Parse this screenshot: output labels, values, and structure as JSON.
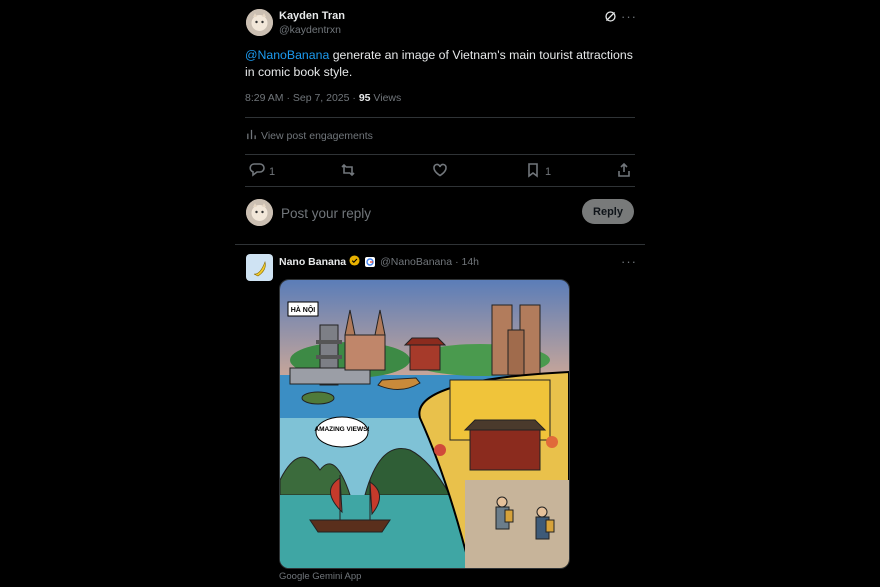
{
  "tweet": {
    "author_name": "Kayden Tran",
    "author_handle": "@kaydentrxn",
    "mention": "@NanoBanana",
    "text": " generate an image of Vietnam's main tourist attractions in comic book style.",
    "time": "8:29 AM · Sep 7, 2025 · ",
    "views_count": "95",
    "views_label": " Views",
    "engagements_label": "View post engagements",
    "actions": {
      "replies": "1",
      "bookmarks": "1"
    }
  },
  "reply_box": {
    "placeholder": "Post your reply",
    "button_label": "Reply"
  },
  "reply": {
    "author_name": "Nano Banana",
    "author_handle": "@NanoBanana",
    "time": "· 14h",
    "image_labels": {
      "city": "HÀ NỘI",
      "speech": "AMAZING VIEWS!"
    },
    "source_caption": "Google Gemini App"
  },
  "colors": {
    "accent": "#1d9bf0",
    "verified": "#e8b100"
  },
  "icons": [
    "grok-icon",
    "more-icon",
    "bar-chart-icon",
    "reply-icon",
    "retweet-icon",
    "like-icon",
    "bookmark-icon",
    "share-icon",
    "verified-badge-icon",
    "google-icon"
  ]
}
